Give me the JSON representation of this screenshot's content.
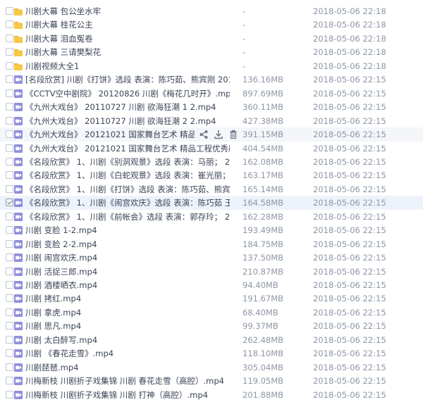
{
  "files": [
    {
      "type": "folder",
      "name": "川剧大幕 包公坐水牢",
      "size": "-",
      "date": "2018-05-06 22:18"
    },
    {
      "type": "folder",
      "name": "川剧大幕 桂花公主",
      "size": "-",
      "date": "2018-05-06 22:18"
    },
    {
      "type": "folder",
      "name": "川剧大幕 泪血冤卷",
      "size": "-",
      "date": "2018-05-06 22:18"
    },
    {
      "type": "folder",
      "name": "川剧大幕 三请樊梨花",
      "size": "-",
      "date": "2018-05-06 22:18"
    },
    {
      "type": "folder",
      "name": "川剧视频大全1",
      "size": "-",
      "date": "2018-05-06 22:18"
    },
    {
      "type": "video",
      "name": "[名段欣赏] 川剧《打饼》选段 表演：陈巧茹、熊宾刚 20130704...",
      "size": "136.16MB",
      "date": "2018-05-06 22:15"
    },
    {
      "type": "video",
      "name": "《CCTV空中剧院》 20120826 川剧《梅花几时开》.mp4",
      "size": "897.69MB",
      "date": "2018-05-06 22:15"
    },
    {
      "type": "video",
      "name": "《九州大戏台》 20110727 川剧 欲海狂潮 1 2.mp4",
      "size": "360.11MB",
      "date": "2018-05-06 22:15"
    },
    {
      "type": "video",
      "name": "《九州大戏台》 20110727 川剧 欲海狂潮 2 2.mp4",
      "size": "427.38MB",
      "date": "2018-05-06 22:15"
    },
    {
      "type": "video",
      "name": "《九州大戏台》 20121021 国家舞台艺术 精品工程优秀剧目选...",
      "size": "391.15MB",
      "date": "2018-05-06 22:15",
      "hover": true
    },
    {
      "type": "video",
      "name": "《九州大戏台》 20121021 国家舞台艺术 精品工程优秀剧目选...",
      "size": "404.54MB",
      "date": "2018-05-06 22:15"
    },
    {
      "type": "video",
      "name": "《名段欣赏》 1、川剧《别洞观景》选段 表演：马丽； 2、川...",
      "size": "162.08MB",
      "date": "2018-05-06 22:15"
    },
    {
      "type": "video",
      "name": "《名段欣赏》 1、川剧《白蛇观景》选段 表演：崔光丽； 2、川...",
      "size": "163.17MB",
      "date": "2018-05-06 22:15"
    },
    {
      "type": "video",
      "name": "《名段欣赏》 1、川剧《打饼》选段 表演：陈巧茹、熊宾刚； 2、川...",
      "size": "165.14MB",
      "date": "2018-05-06 22:15"
    },
    {
      "type": "video",
      "name": "《名段欣赏》 1、川剧《闹宫欢庆》选段 表演：陈巧茹 王超 王...",
      "size": "164.58MB",
      "date": "2018-05-06 22:15",
      "checked": true
    },
    {
      "type": "video",
      "name": "《名段欣赏》 1、川剧《前帐会》选段 表演：郭存玲； 2、川剧...",
      "size": "162.28MB",
      "date": "2018-05-06 22:15"
    },
    {
      "type": "video",
      "name": "川剧 变脸 1-2.mp4",
      "size": "193.49MB",
      "date": "2018-05-06 22:15"
    },
    {
      "type": "video",
      "name": "川剧 变脸 2-2.mp4",
      "size": "184.75MB",
      "date": "2018-05-06 22:15"
    },
    {
      "type": "video",
      "name": "川剧 闹宫欢庆.mp4",
      "size": "137.50MB",
      "date": "2018-05-06 22:15"
    },
    {
      "type": "video",
      "name": "川剧 活捉三郎.mp4",
      "size": "210.87MB",
      "date": "2018-05-06 22:15"
    },
    {
      "type": "video",
      "name": "川剧 酒楼晒衣.mp4",
      "size": "94.40MB",
      "date": "2018-05-06 22:15"
    },
    {
      "type": "video",
      "name": "川剧 拷红.mp4",
      "size": "191.67MB",
      "date": "2018-05-06 22:15"
    },
    {
      "type": "video",
      "name": "川剧 拿虎.mp4",
      "size": "68.40MB",
      "date": "2018-05-06 22:15"
    },
    {
      "type": "video",
      "name": "川剧 思凡.mp4",
      "size": "99.37MB",
      "date": "2018-05-06 22:15"
    },
    {
      "type": "video",
      "name": "川剧 太白醉写.mp4",
      "size": "262.48MB",
      "date": "2018-05-06 22:15"
    },
    {
      "type": "video",
      "name": "川剧 《春花走雪》.mp4",
      "size": "118.10MB",
      "date": "2018-05-06 22:15"
    },
    {
      "type": "video",
      "name": "川剧琵琶.mp4",
      "size": "305.04MB",
      "date": "2018-05-06 22:15"
    },
    {
      "type": "video",
      "name": "川梅新枝 川剧折子戏集锦 川剧 春花走雪（高腔）.mp4",
      "size": "119.05MB",
      "date": "2018-05-06 22:15"
    },
    {
      "type": "video",
      "name": "川梅新枝 川剧折子戏集锦 川剧 打神（高腔）.mp4",
      "size": "201.88MB",
      "date": "2018-05-06 22:15"
    }
  ],
  "row_actions": [
    "share-icon",
    "download-icon",
    "delete-icon"
  ],
  "colors": {
    "folder": "#f7c846",
    "video": "#8f8fd9",
    "hover_bg": "#f4f6f9",
    "text": "#3b4558",
    "meta": "#8d96a6"
  }
}
